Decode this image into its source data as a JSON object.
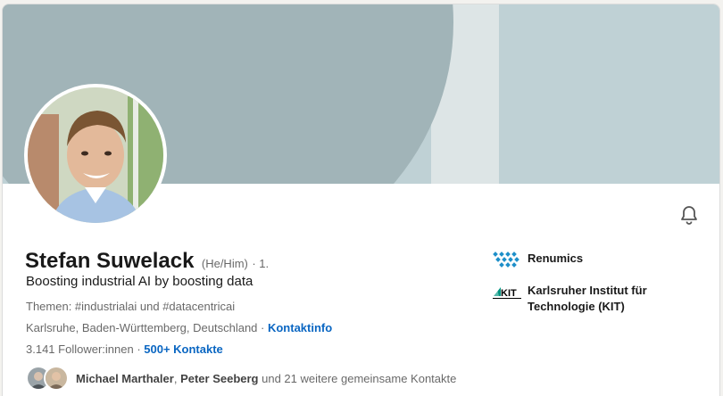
{
  "profile": {
    "name": "Stefan Suwelack",
    "pronouns": "(He/Him)",
    "degree": "· 1.",
    "headline": "Boosting industrial AI by boosting data",
    "topics": "Themen: #industrialai und #datacentricai",
    "location": "Karlsruhe, Baden-Württemberg, Deutschland",
    "separator": " · ",
    "contact_info_label": "Kontaktinfo",
    "followers": "3.141 Follower:innen",
    "followers_separator": " · ",
    "connections_label": "500+ Kontakte"
  },
  "mutual": {
    "person1": "Michael Marthaler",
    "comma": ", ",
    "person2": "Peter Seeberg",
    "rest": " und 21 weitere gemeinsame Kontakte"
  },
  "organizations": [
    {
      "label": "Renumics",
      "logo": "renumics-logo"
    },
    {
      "label_line1": "Karlsruher Institut für",
      "label_line2": "Technologie (KIT)",
      "logo": "kit-logo"
    }
  ],
  "icons": {
    "notifications": "bell-icon"
  },
  "colors": {
    "link": "#0a66c2",
    "banner_dark": "#a1b4b8",
    "banner_light": "#bfd1d5",
    "banner_stripe": "#dde5e6",
    "renumics": "#1d8fc9",
    "kit_teal": "#009682"
  }
}
